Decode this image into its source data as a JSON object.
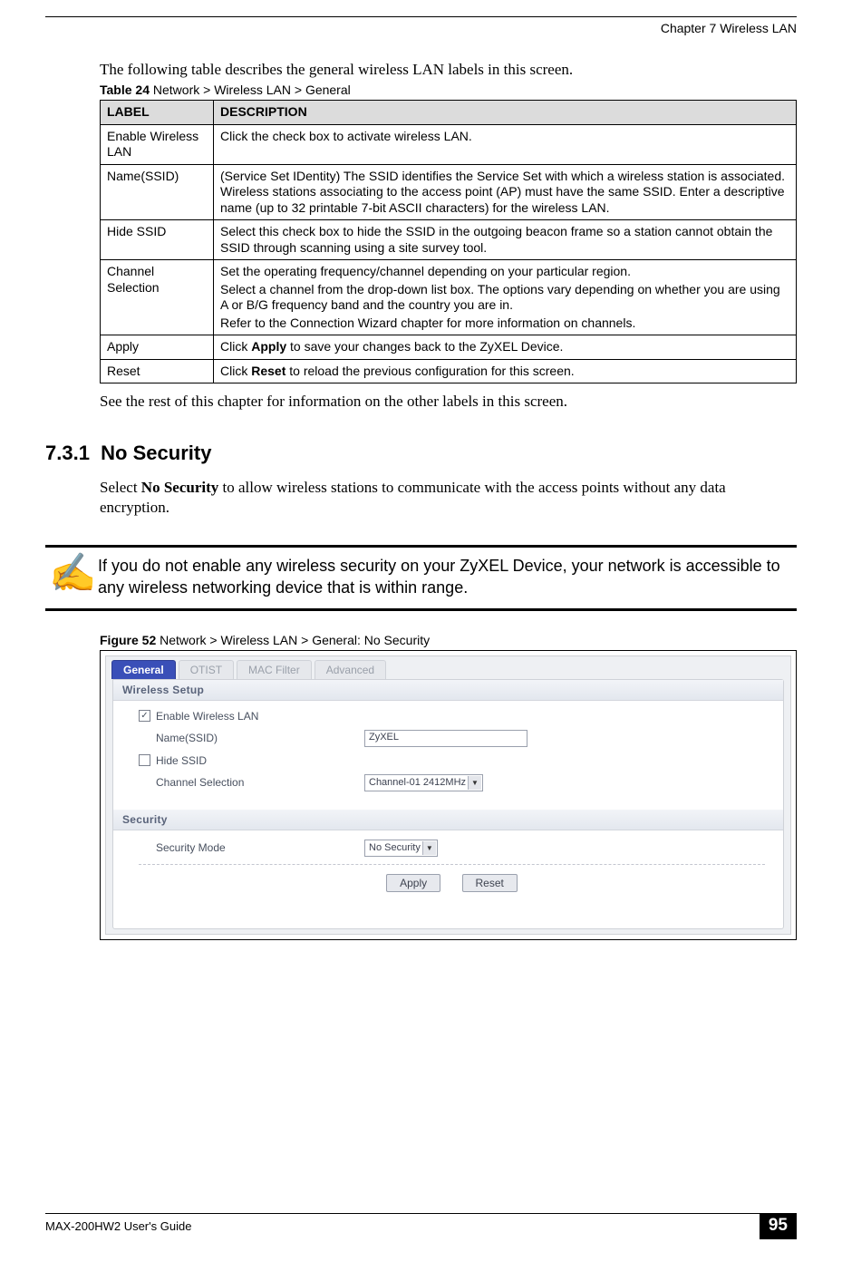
{
  "chapter_label": "Chapter 7 Wireless LAN",
  "intro_text": "The following table describes the general wireless LAN labels in this screen.",
  "table_caption_bold": "Table 24",
  "table_caption_rest": "   Network > Wireless LAN > General",
  "table_headers": {
    "label": "LABEL",
    "desc": "DESCRIPTION"
  },
  "table_rows": [
    {
      "label": "Enable Wireless LAN",
      "desc_parts": [
        "Click the check box to activate wireless LAN."
      ]
    },
    {
      "label": "Name(SSID)",
      "desc_parts": [
        "(Service Set IDentity) The SSID identifies the Service Set with which a wireless station is associated. Wireless stations associating to the access point (AP) must have the same SSID. Enter a descriptive name (up to 32 printable 7-bit ASCII characters) for the wireless LAN."
      ]
    },
    {
      "label": "Hide SSID",
      "desc_parts": [
        "Select this check box to hide the SSID in the outgoing beacon frame so a station cannot obtain the SSID through scanning using a site survey tool."
      ]
    },
    {
      "label": "Channel Selection",
      "desc_parts": [
        "Set the operating frequency/channel depending on your particular region.",
        "Select a channel from the drop-down list box. The options vary depending on whether you are using A or B/G frequency band and the country you are in.",
        "Refer to the Connection Wizard chapter for more information on channels."
      ]
    },
    {
      "label": "Apply",
      "desc_parts": [
        "Click <b>Apply</b> to save your changes back to the ZyXEL Device."
      ]
    },
    {
      "label": "Reset",
      "desc_parts": [
        "Click <b>Reset</b> to reload the previous configuration for this screen."
      ]
    }
  ],
  "after_table_text": "See the rest of this chapter for information on the other labels in this screen.",
  "section_number": "7.3.1",
  "section_title": "No Security",
  "section_body_pre": "Select ",
  "section_body_bold": "No Security",
  "section_body_post": " to allow wireless stations to communicate with the access points without any data encryption.",
  "note_icon": "✍",
  "note_text": "If you do not enable any wireless security on your ZyXEL Device, your network is accessible to any wireless networking device that is within range.",
  "figure_caption_bold": "Figure 52",
  "figure_caption_rest": "   Network > Wireless LAN > General: No Security",
  "screenshot": {
    "tabs": [
      "General",
      "OTIST",
      "MAC Filter",
      "Advanced"
    ],
    "active_tab_index": 0,
    "group1_title": "Wireless Setup",
    "enable_wlan_checked": true,
    "enable_wlan_label": "Enable Wireless LAN",
    "name_ssid_label": "Name(SSID)",
    "name_ssid_value": "ZyXEL",
    "hide_ssid_checked": false,
    "hide_ssid_label": "Hide SSID",
    "channel_label": "Channel Selection",
    "channel_value": "Channel-01 2412MHz",
    "group2_title": "Security",
    "security_mode_label": "Security Mode",
    "security_mode_value": "No Security",
    "apply_label": "Apply",
    "reset_label": "Reset"
  },
  "footer_left": "MAX-200HW2 User's Guide",
  "footer_page": "95"
}
